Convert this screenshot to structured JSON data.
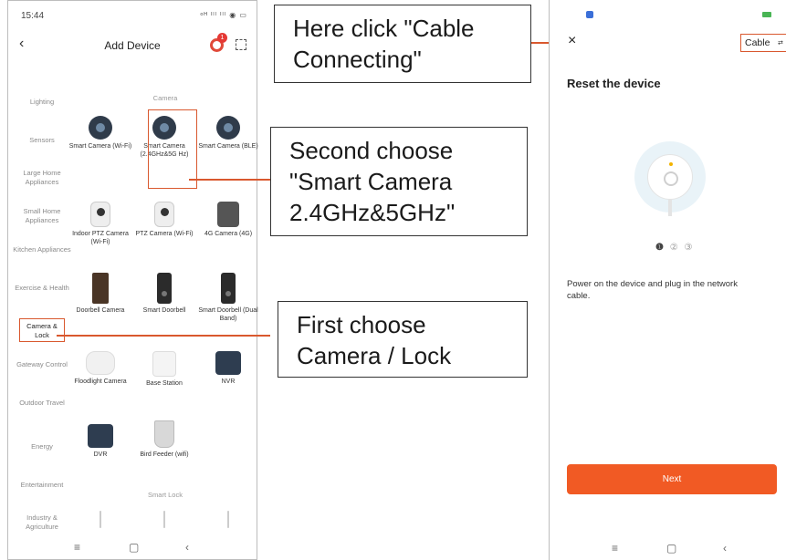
{
  "left_phone": {
    "status_time": "15:44",
    "status_icons": "ᵒᴴ ᴵˡˡ ᴵˡˡ ◉ ▭",
    "title": "Add Device",
    "badge_count": "1",
    "categories": [
      {
        "label": "Lighting"
      },
      {
        "label": "Sensors"
      },
      {
        "label": "Large Home Appliances"
      },
      {
        "label": "Small Home Appliances"
      },
      {
        "label": "Kitchen Appliances"
      },
      {
        "label": "Exercise & Health"
      },
      {
        "label": "Camera & Lock"
      },
      {
        "label": "Gateway Control"
      },
      {
        "label": "Outdoor Travel"
      },
      {
        "label": "Energy"
      },
      {
        "label": "Entertainment"
      },
      {
        "label": "Industry & Agriculture"
      }
    ],
    "section_camera": "Camera",
    "section_lock": "Smart Lock",
    "devices": [
      {
        "label": "Smart Camera (Wi-Fi)",
        "icon": "camera-icon"
      },
      {
        "label": "Smart Camera (2.4GHz&5G Hz)",
        "icon": "camera-icon"
      },
      {
        "label": "Smart Camera (BLE)",
        "icon": "camera-icon"
      },
      {
        "label": "Indoor PTZ Camera (Wi-Fi)",
        "icon": "ptz-camera-icon"
      },
      {
        "label": "PTZ Camera (Wi-Fi)",
        "icon": "outdoor-ptz-icon"
      },
      {
        "label": "4G Camera (4G)",
        "icon": "4g-camera-icon"
      },
      {
        "label": "Doorbell Camera",
        "icon": "doorbell-camera-icon"
      },
      {
        "label": "Smart Doorbell",
        "icon": "doorbell-icon"
      },
      {
        "label": "Smart Doorbell (Dual Band)",
        "icon": "doorbell-icon"
      },
      {
        "label": "Floodlight Camera",
        "icon": "floodlight-icon"
      },
      {
        "label": "Base Station",
        "icon": "base-station-icon"
      },
      {
        "label": "NVR",
        "icon": "nvr-icon"
      },
      {
        "label": "DVR",
        "icon": "dvr-icon"
      },
      {
        "label": "Bird Feeder (wifi)",
        "icon": "bird-feeder-icon"
      }
    ],
    "nav": {
      "menu": "≡",
      "home": "▢",
      "back": "‹"
    }
  },
  "callouts": {
    "first": [
      "First choose",
      "Camera / Lock"
    ],
    "second": [
      "Second choose",
      "\"Smart Camera",
      "2.4GHz&5GHz\""
    ],
    "third": [
      "Here click \"Cable",
      "Connecting\""
    ]
  },
  "right_phone": {
    "close": "×",
    "cable_label": "Cable",
    "title": "Reset the device",
    "steps": [
      "❶",
      "②",
      "③"
    ],
    "instruction": "Power on the device and plug in the network cable.",
    "next_label": "Next",
    "nav": {
      "menu": "≡",
      "home": "▢",
      "back": "‹"
    }
  },
  "colors": {
    "accent": "#f15a24",
    "highlight_box": "#d9582e"
  }
}
